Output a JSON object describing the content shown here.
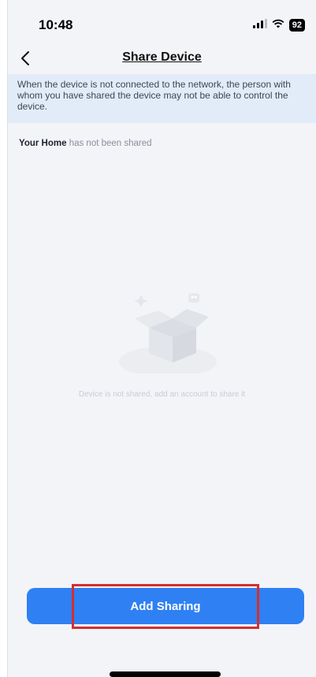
{
  "status_bar": {
    "time": "10:48",
    "battery": "92"
  },
  "nav": {
    "title": "Share Device"
  },
  "notice": {
    "text": "When the device is not connected to the network, the person with whom you have shared the device may not be able to control the device."
  },
  "share_status": {
    "home_name": "Your Home",
    "suffix": " has not been shared"
  },
  "empty_state": {
    "message": "Device is not shared, add an account to share it"
  },
  "actions": {
    "add_sharing_label": "Add Sharing"
  },
  "colors": {
    "primary": "#2f80f3",
    "background": "#f2f4f8",
    "notice_bg": "#e2ecf8",
    "highlight": "#d32f2f"
  }
}
